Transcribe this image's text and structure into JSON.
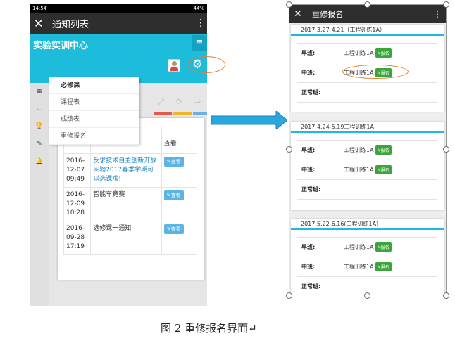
{
  "left": {
    "status": {
      "time": "14:54",
      "battery": "44%"
    },
    "appbar": {
      "close": "✕",
      "title": "通知列表",
      "more": "⋮"
    },
    "site_title": "实验实训中心",
    "menu_icon": "≡",
    "settings_icon": "⚙",
    "sidebar_icons": [
      "▦",
      "▭",
      "🏆",
      "✎",
      "🔔"
    ],
    "menu": [
      "必修课",
      "课程表",
      "成绩表",
      "重修报名"
    ],
    "toolbar_icons": [
      "⤢",
      "⟳",
      "⇒"
    ],
    "strip_colors": [
      "#e05c4a",
      "#f0b429",
      "#6ab0e8"
    ],
    "table": {
      "col_view": "查看",
      "rows": [
        {
          "date_y": "2016-",
          "date_md": "12-07",
          "time": "09:49",
          "title": "反求技术自主创新开放实验2017春季学期可以选课啦!",
          "link": true,
          "btn": "✎查看"
        },
        {
          "date_y": "2016-",
          "date_md": "12-09",
          "time": "10:28",
          "title": "智能车竞赛",
          "link": false,
          "btn": "✎查看"
        },
        {
          "date_y": "2016-",
          "date_md": "09-28",
          "time": "17:19",
          "title": "选修课一通知",
          "link": false,
          "btn": "✎查看"
        }
      ]
    }
  },
  "right": {
    "appbar": {
      "close": "✕",
      "title": "重修报名",
      "more": "⋮"
    },
    "cards": [
      {
        "header": "2017.3.27-4.21（工程训练1A）",
        "rows": [
          {
            "label": "早班:",
            "course": "工程训练1A",
            "btn": "✎报名"
          },
          {
            "label": "中班:",
            "course": "工程训练1A",
            "btn": "✎报名"
          },
          {
            "label": "正常班:",
            "course": "",
            "btn": ""
          }
        ]
      },
      {
        "header": "2017.4.24-5.19工程训练1A",
        "rows": [
          {
            "label": "早班:",
            "course": "工程训练1A",
            "btn": "✎报名"
          },
          {
            "label": "中班:",
            "course": "工程训练1A",
            "btn": "✎报名"
          },
          {
            "label": "正常班:",
            "course": "",
            "btn": ""
          }
        ]
      },
      {
        "header": "2017.5.22-6.16(工程训练1A)",
        "rows": [
          {
            "label": "早班:",
            "course": "工程训练1A",
            "btn": "✎报名"
          },
          {
            "label": "中班:",
            "course": "工程训练1A",
            "btn": "✎报名"
          },
          {
            "label": "正常班:",
            "course": "",
            "btn": ""
          }
        ]
      }
    ]
  },
  "colors": {
    "cyan": "#1ebcdb",
    "dark": "#2e2e2e",
    "green": "#3aa63a",
    "blue_btn": "#5bb3e6",
    "oval": "#e08030",
    "arrow": "#29a8df"
  },
  "caption": "图 2 重修报名界面↵"
}
